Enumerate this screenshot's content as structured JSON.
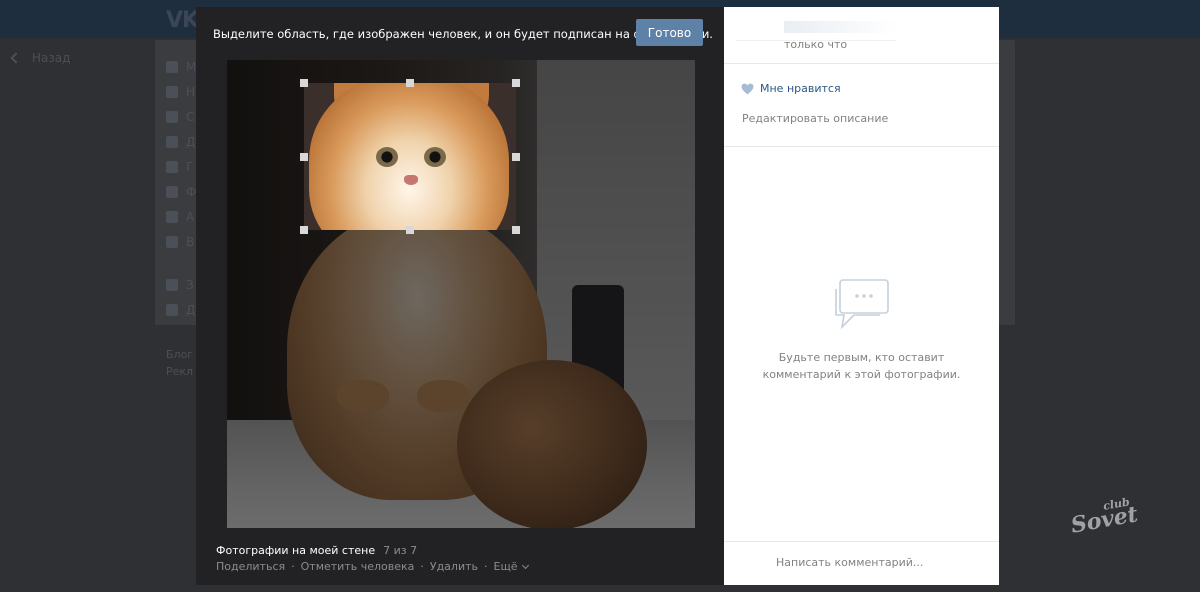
{
  "background": {
    "logo": "VK",
    "back_label": "Назад",
    "menu_items": [
      "М",
      "Н",
      "С",
      "Д",
      "Г",
      "Ф",
      "А",
      "В",
      "З",
      "Д"
    ],
    "footer": [
      "Блог",
      "Рекл"
    ]
  },
  "viewer": {
    "instruction": "Выделите область, где изображен человек, и он будет подписан на фотографии.",
    "done_label": "Готово",
    "album_title": "Фотографии на моей стене",
    "album_count": "7 из 7",
    "actions": [
      "Поделиться",
      "Отметить человека",
      "Удалить",
      "Ещё"
    ]
  },
  "side": {
    "time": "только что",
    "like_label": "Мне нравится",
    "edit_label": "Редактировать описание",
    "empty_line1": "Будьте первым, кто оставит",
    "empty_line2": "комментарий к этой фотографии.",
    "write_comment": "Написать комментарий..."
  },
  "watermark": {
    "club": "club",
    "brand": "Sovet"
  },
  "colors": {
    "accent": "#5e81a8",
    "link": "#2a5885",
    "muted": "#828282"
  }
}
